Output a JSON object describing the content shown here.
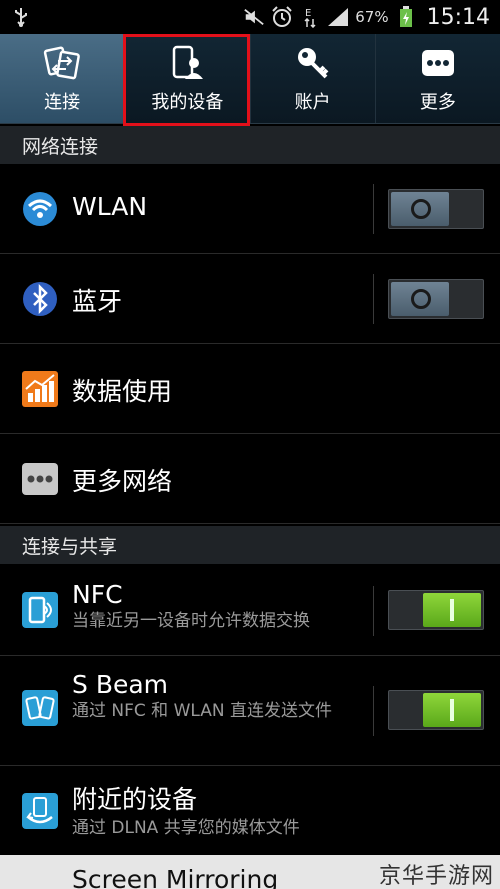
{
  "status_bar": {
    "battery_pct": "67%",
    "time": "15:14",
    "icons": [
      "usb-icon",
      "mute-icon",
      "alarm-icon",
      "edge-data-icon",
      "signal-icon",
      "battery-icon"
    ]
  },
  "tabs": [
    {
      "label": "连接",
      "icon": "connection-icon",
      "active": true
    },
    {
      "label": "我的设备",
      "icon": "my-device-icon",
      "active": false
    },
    {
      "label": "账户",
      "icon": "key-icon",
      "active": false
    },
    {
      "label": "更多",
      "icon": "more-icon",
      "active": false
    }
  ],
  "sections": {
    "network": "网络连接",
    "sharing": "连接与共享"
  },
  "rows": {
    "wlan": {
      "title": "WLAN",
      "toggle": "off",
      "icon": "wifi-icon"
    },
    "bluetooth": {
      "title": "蓝牙",
      "toggle": "off",
      "icon": "bluetooth-icon"
    },
    "data_usage": {
      "title": "数据使用",
      "icon": "data-usage-icon"
    },
    "more_networks": {
      "title": "更多网络",
      "icon": "more-networks-icon"
    },
    "nfc": {
      "title": "NFC",
      "subtitle": "当靠近另一设备时允许数据交换",
      "toggle": "on",
      "icon": "nfc-icon"
    },
    "sbeam": {
      "title": "S Beam",
      "subtitle": "通过 NFC 和 WLAN 直连发送文件",
      "toggle": "on",
      "icon": "sbeam-icon"
    },
    "nearby": {
      "title": "附近的设备",
      "subtitle": "通过 DLNA 共享您的媒体文件",
      "icon": "nearby-devices-icon"
    },
    "screen_mirroring": {
      "title": "Screen Mirroring"
    }
  },
  "watermark": "京华手游网",
  "colors": {
    "highlight_box": "#e3101a",
    "toggle_on": "#7cc52a",
    "toggle_off": "#5a6e7e",
    "active_tab": "#3c5e78"
  }
}
